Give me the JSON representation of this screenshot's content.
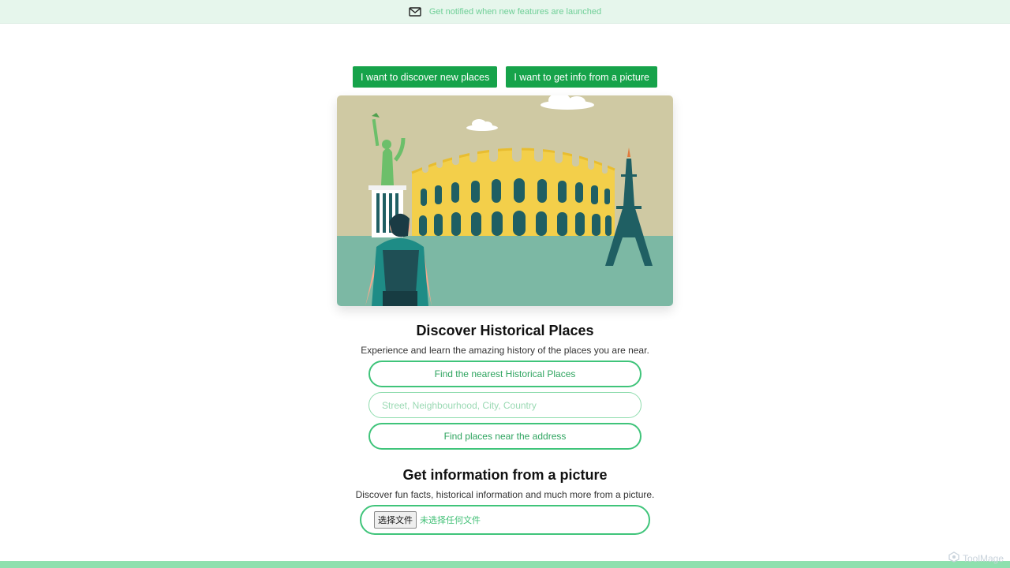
{
  "banner": {
    "text": "Get notified when new features are launched",
    "icon": "mail-icon"
  },
  "mode_buttons": {
    "discover_label": "I want to discover new places",
    "picture_label": "I want to get info from a picture"
  },
  "colors": {
    "primary": "#16a34a",
    "accent_border": "#3fc47a",
    "banner_bg": "#e6f6ec",
    "footer_bar": "#8ee0ae"
  },
  "discover": {
    "title": "Discover Historical Places",
    "subtitle": "Experience and learn the amazing history of the places you are near.",
    "nearest_button": "Find the nearest Historical Places",
    "address_placeholder": "Street, Neighbourhood, City, Country",
    "address_value": "",
    "near_address_button": "Find places near the address"
  },
  "picture": {
    "title": "Get information from a picture",
    "subtitle": "Discover fun facts, historical information and much more from a picture.",
    "choose_file_label": "选择文件",
    "file_status": "未选择任何文件"
  },
  "watermark": {
    "text": "ToolMage"
  }
}
